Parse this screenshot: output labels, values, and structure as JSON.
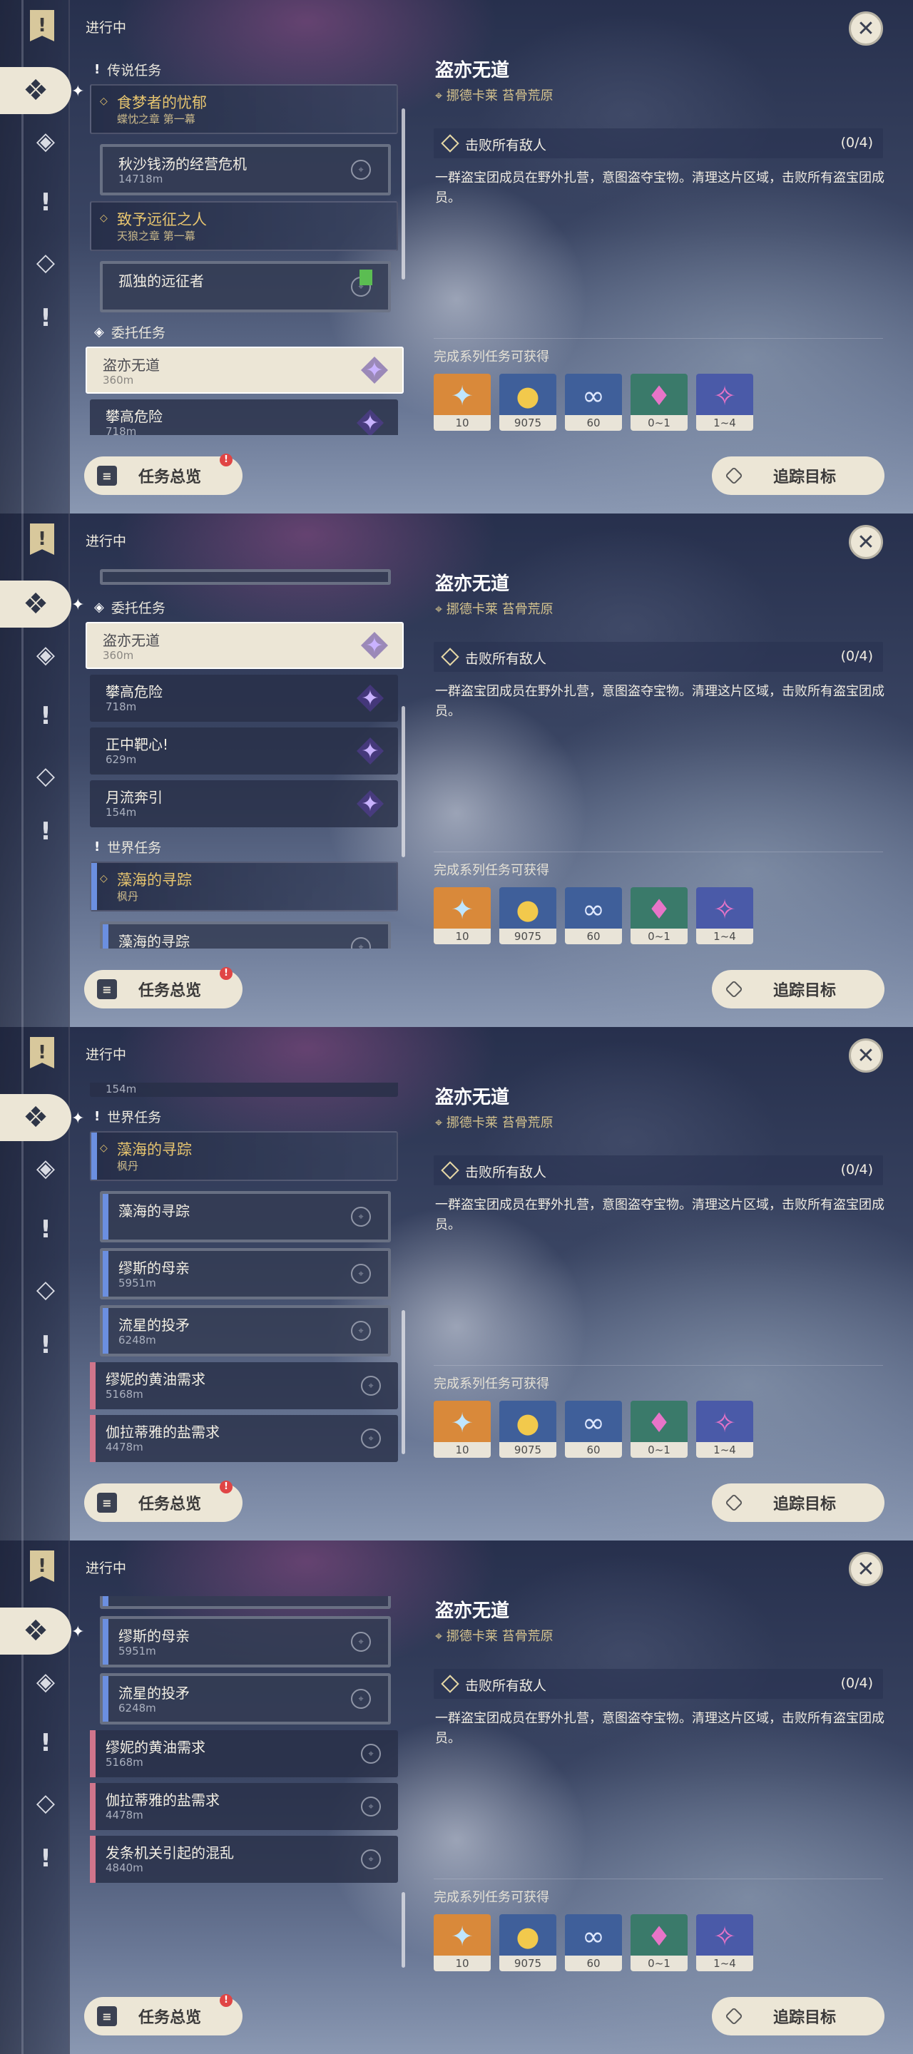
{
  "header": {
    "status": "进行中"
  },
  "quest": {
    "title": "盗亦无道",
    "location": "挪德卡莱 苔骨荒原",
    "objective": "击败所有敌人",
    "progress": "(0/4)",
    "description": "一群盗宝团成员在野外扎营，意图盗夺宝物。清理这片区域，击败所有盗宝团成员。",
    "rewards_label": "完成系列任务可获得"
  },
  "rewards": [
    {
      "icon": "star-icon",
      "count": "10",
      "bg": "#d9893a",
      "color": "#bfe6ff"
    },
    {
      "icon": "mora-icon",
      "count": "9075",
      "bg": "#3f5f9a",
      "color": "#f2c94c"
    },
    {
      "icon": "fellowship-icon",
      "count": "60",
      "bg": "#3f5f9a",
      "color": "#dfe8ff"
    },
    {
      "icon": "crystal-icon",
      "count": "0~1",
      "bg": "#3a7a6a",
      "color": "#e874c8"
    },
    {
      "icon": "crystal-cluster-icon",
      "count": "1~4",
      "bg": "#4a5aa8",
      "color": "#e874c8"
    }
  ],
  "buttons": {
    "overview": "任务总览",
    "track": "追踪目标",
    "badge": "!"
  },
  "panels": [
    {
      "scroll_top": 0.14,
      "scroll_len": 0.45,
      "items": [
        {
          "kind": "section",
          "icon": "!",
          "text": "传说任务"
        },
        {
          "kind": "parent",
          "title": "食梦者的忧郁",
          "sub": "蝶忱之章 第一幕"
        },
        {
          "kind": "child",
          "title": "秋沙钱汤的经营危机",
          "sub": "14718m",
          "pin": true
        },
        {
          "kind": "parent",
          "title": "致予远征之人",
          "sub": "天狼之章 第一幕"
        },
        {
          "kind": "child",
          "title": "孤独的远征者",
          "sub": "",
          "pin": true,
          "flag": true
        },
        {
          "kind": "section",
          "icon": "◈",
          "text": "委托任务"
        },
        {
          "kind": "sel",
          "title": "盗亦无道",
          "sub": "360m",
          "star": true
        },
        {
          "kind": "item",
          "title": "攀高危险",
          "sub": "718m",
          "star": true
        }
      ]
    },
    {
      "scroll_top": 0.36,
      "scroll_len": 0.4,
      "items": [
        {
          "kind": "stub"
        },
        {
          "kind": "section",
          "icon": "◈",
          "text": "委托任务"
        },
        {
          "kind": "sel",
          "title": "盗亦无道",
          "sub": "360m",
          "star": true
        },
        {
          "kind": "item",
          "title": "攀高危险",
          "sub": "718m",
          "star": true
        },
        {
          "kind": "item",
          "title": "正中靶心!",
          "sub": "629m",
          "star": true
        },
        {
          "kind": "item",
          "title": "月流奔引",
          "sub": "154m",
          "star": true
        },
        {
          "kind": "section",
          "icon": "!",
          "text": "世界任务"
        },
        {
          "kind": "parent",
          "title": "藻海的寻踪",
          "sub": "枫丹",
          "blue": true
        },
        {
          "kind": "child",
          "title": "藻海的寻踪",
          "sub": "",
          "pin": true,
          "blue": true
        }
      ]
    },
    {
      "scroll_top": 0.6,
      "scroll_len": 0.38,
      "items": [
        {
          "kind": "stubitem",
          "sub": "154m"
        },
        {
          "kind": "section",
          "icon": "!",
          "text": "世界任务"
        },
        {
          "kind": "parent",
          "title": "藻海的寻踪",
          "sub": "枫丹",
          "blue": true
        },
        {
          "kind": "child",
          "title": "藻海的寻踪",
          "sub": "",
          "pin": true,
          "blue": true
        },
        {
          "kind": "child",
          "title": "缪斯的母亲",
          "sub": "5951m",
          "pin": true,
          "blue": true
        },
        {
          "kind": "child",
          "title": "流星的投矛",
          "sub": "6248m",
          "pin": true,
          "blue": true
        },
        {
          "kind": "item",
          "title": "缪妮的黄油需求",
          "sub": "5168m",
          "pin": true,
          "pink": true
        },
        {
          "kind": "item",
          "title": "伽拉蒂雅的盐需求",
          "sub": "4478m",
          "pin": true,
          "pink": true
        }
      ]
    },
    {
      "scroll_top": 0.78,
      "scroll_len": 0.2,
      "items": [
        {
          "kind": "stubchild"
        },
        {
          "kind": "child",
          "title": "缪斯的母亲",
          "sub": "5951m",
          "pin": true,
          "blue": true
        },
        {
          "kind": "child",
          "title": "流星的投矛",
          "sub": "6248m",
          "pin": true,
          "blue": true
        },
        {
          "kind": "item",
          "title": "缪妮的黄油需求",
          "sub": "5168m",
          "pin": true,
          "pink": true
        },
        {
          "kind": "item",
          "title": "伽拉蒂雅的盐需求",
          "sub": "4478m",
          "pin": true,
          "pink": true
        },
        {
          "kind": "item",
          "title": "发条机关引起的混乱",
          "sub": "4840m",
          "pin": true,
          "pink": true
        }
      ]
    }
  ]
}
